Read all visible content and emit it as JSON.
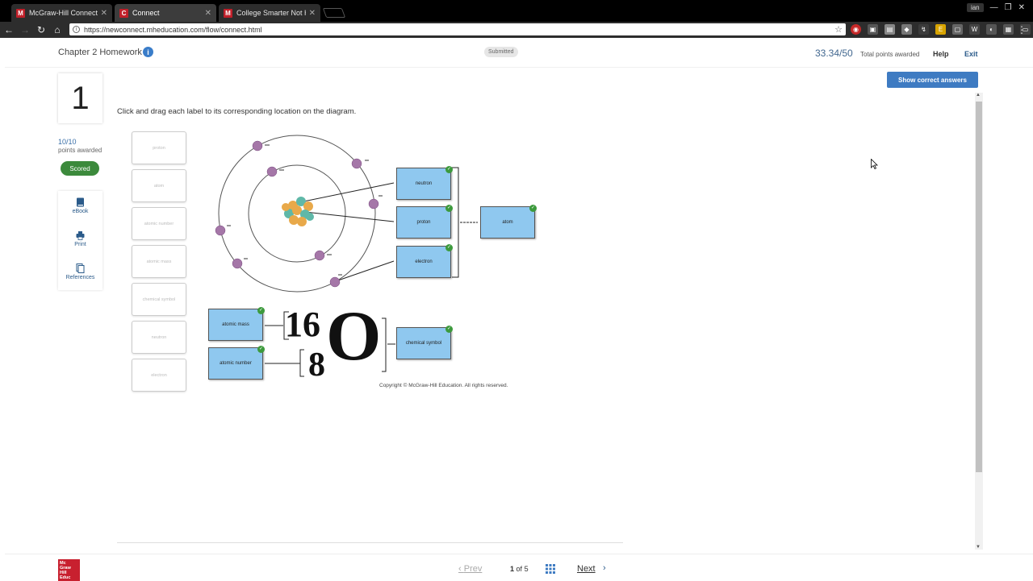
{
  "browser": {
    "tabs": [
      {
        "favicon": "M",
        "title": "McGraw-Hill Connect | St"
      },
      {
        "favicon": "C",
        "title": "Connect"
      },
      {
        "favicon": "M",
        "title": "College Smarter Not Har"
      }
    ],
    "url": "https://newconnect.mheducation.com/flow/connect.html",
    "user": "ian"
  },
  "header": {
    "title": "Chapter 2 Homework",
    "status": "Submitted",
    "score": "33.34/50",
    "score_label": "Total points awarded",
    "help": "Help",
    "exit": "Exit"
  },
  "question": {
    "number": "1",
    "points": "10/10",
    "points_label": "points awarded",
    "status": "Scored",
    "instruction": "Click and drag each label to its corresponding location on the diagram."
  },
  "tools": [
    {
      "label": "eBook",
      "icon": "book-icon"
    },
    {
      "label": "Print",
      "icon": "printer-icon"
    },
    {
      "label": "References",
      "icon": "document-icon"
    }
  ],
  "show_answers": "Show correct answers",
  "palette": [
    "proton",
    "atom",
    "atomic number",
    "atomic mass",
    "chemical symbol",
    "neutron",
    "electron"
  ],
  "placed": {
    "neutron": "neutron",
    "proton": "proton",
    "electron": "electron",
    "atom": "atom",
    "atomic_mass": "atomic mass",
    "atomic_number": "atomic number",
    "chemical_symbol": "chemical symbol"
  },
  "isotope": {
    "mass": "16",
    "number": "8",
    "symbol": "O"
  },
  "copyright": "Copyright © McGraw-Hill Education. All rights reserved.",
  "footer": {
    "logo": "Mc Graw Hill Education",
    "prev": "Prev",
    "current": "1",
    "of": "of",
    "total": "5",
    "next": "Next"
  }
}
